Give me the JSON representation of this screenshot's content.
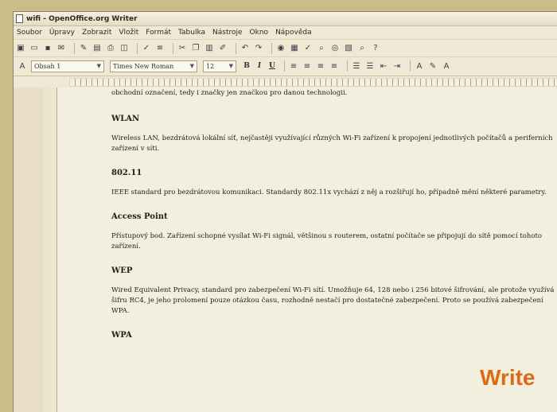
{
  "window": {
    "title": "wifi - OpenOffice.org Writer"
  },
  "menubar": [
    "Soubor",
    "Úpravy",
    "Zobrazit",
    "Vložit",
    "Formát",
    "Tabulka",
    "Nástroje",
    "Okno",
    "Nápověda"
  ],
  "toolbar": {
    "icons": [
      "new-document-icon",
      "open-icon",
      "save-icon",
      "email-icon",
      "edit-icon",
      "export-pdf-icon",
      "print-icon",
      "preview-icon",
      "spellcheck-icon",
      "autocheck-icon",
      "cut-icon",
      "copy-icon",
      "paste-icon",
      "format-paint-icon",
      "undo-icon",
      "redo-icon",
      "hyperlink-icon",
      "table-icon",
      "show-draw-icon",
      "find-icon",
      "navigator-icon",
      "gallery-icon",
      "zoom-icon",
      "help-icon"
    ]
  },
  "format": {
    "style": "Obsah 1",
    "font": "Times New Roman",
    "size": "12",
    "buttons": [
      "B",
      "I",
      "U"
    ],
    "align_icons": [
      "align-left-icon",
      "align-center-icon",
      "align-right-icon",
      "justify-icon"
    ],
    "list_icons": [
      "numbered-list-icon",
      "bullet-list-icon",
      "decrease-indent-icon",
      "increase-indent-icon"
    ],
    "color_icons": [
      "font-color-icon",
      "highlight-icon",
      "background-color-icon"
    ]
  },
  "document": {
    "paragraphs": [
      {
        "type": "text",
        "text": "obchodní označení, tedy i značky jen značkou pro danou technologii."
      },
      {
        "type": "heading",
        "text": "WLAN"
      },
      {
        "type": "text",
        "text": "Wireless LAN, bezdrátová lokální síť, nejčastěji využívající různých Wi-Fi zařízení k propojení jednotlivých počítačů a periferních zařízení v síti."
      },
      {
        "type": "heading",
        "text": "802.11"
      },
      {
        "type": "text",
        "text": "IEEE standard pro bezdrátovou komunikaci. Standardy 802.11x vychází z něj a rozšiřují ho, případně mění některé parametry."
      },
      {
        "type": "heading",
        "text": "Access Point"
      },
      {
        "type": "text",
        "text": "Přístupový bod. Zařízení schopné vysílat Wi-Fi signál, většinou s routerem, ostatní počítače se připojují do sítě pomocí tohoto zařízení."
      },
      {
        "type": "heading",
        "text": "WEP"
      },
      {
        "type": "text",
        "text": "Wired Equivalent Privacy, standard pro zabezpečení Wi-Fi sítí. Umožňuje 64, 128 nebo i 256 bitové šifrování, ale protože využívá šifru RC4, je jeho prolomení pouze otázkou času, rozhodně nestačí pro dostatečné zabezpečení. Proto se používá zabezpečení WPA."
      },
      {
        "type": "heading",
        "text": "WPA"
      }
    ]
  },
  "overlay": {
    "label": "Write"
  }
}
